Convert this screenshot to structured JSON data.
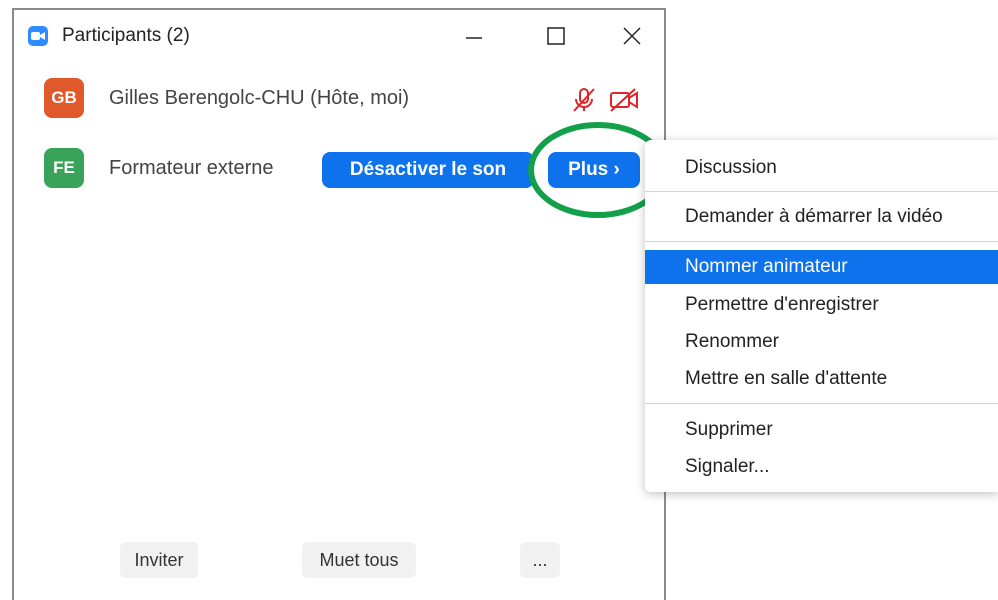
{
  "window": {
    "title": "Participants (2)"
  },
  "participants": [
    {
      "initials": "GB",
      "name": "Gilles Berengolc-CHU (Hôte, moi)",
      "avatar_color": "#e0592a"
    },
    {
      "initials": "FE",
      "name": "Formateur externe",
      "avatar_color": "#3aa35b"
    }
  ],
  "row_actions": {
    "mute_label": "Désactiver le son",
    "more_label": "Plus ›"
  },
  "footer": {
    "invite_label": "Inviter",
    "mute_all_label": "Muet tous",
    "more_label": "..."
  },
  "context_menu": {
    "items": [
      "Discussion",
      "Demander à démarrer la vidéo",
      "Nommer animateur",
      "Permettre d'enregistrer",
      "Renommer",
      "Mettre en salle d'attente",
      "Supprimer",
      "Signaler..."
    ],
    "selected": "Nommer animateur"
  },
  "colors": {
    "accent": "#0e72ed",
    "annotation": "#13a04a",
    "muted_icon": "#e0242a"
  }
}
